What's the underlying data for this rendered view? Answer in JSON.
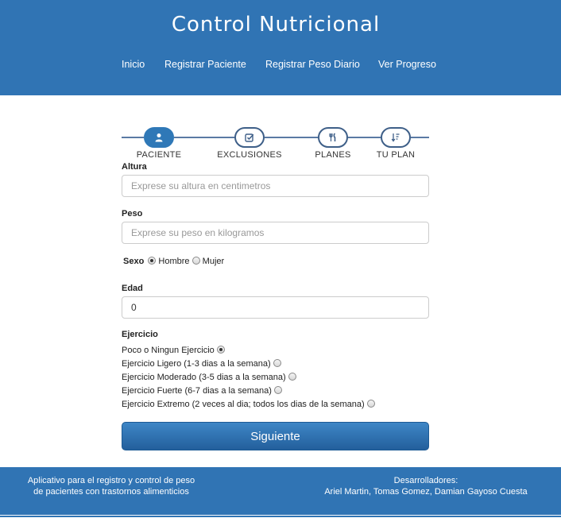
{
  "header": {
    "title": "Control Nutricional",
    "nav": [
      "Inicio",
      "Registrar Paciente",
      "Registrar Peso Diario",
      "Ver Progreso"
    ]
  },
  "stepper": {
    "steps": [
      {
        "label": "PACIENTE",
        "icon": "user-icon",
        "active": true
      },
      {
        "label": "EXCLUSIONES",
        "icon": "checkbox-icon",
        "active": false
      },
      {
        "label": "PLANES",
        "icon": "cutlery-icon",
        "active": false
      },
      {
        "label": "TU PLAN",
        "icon": "sort-icon",
        "active": false
      }
    ]
  },
  "form": {
    "altura": {
      "label": "Altura",
      "placeholder": "Exprese su altura en centimetros",
      "value": ""
    },
    "peso": {
      "label": "Peso",
      "placeholder": "Exprese su peso en kilogramos",
      "value": ""
    },
    "sexo": {
      "label": "Sexo",
      "options": [
        "Hombre",
        "Mujer"
      ],
      "selected": "Hombre"
    },
    "edad": {
      "label": "Edad",
      "value": "0"
    },
    "ejercicio": {
      "label": "Ejercicio",
      "options": [
        "Poco o Ningun Ejercicio",
        "Ejercicio Ligero (1-3 dias a la semana)",
        "Ejercicio Moderado (3-5 dias a la semana)",
        "Ejercicio Fuerte (6-7 dias a la semana)",
        "Ejercicio Extremo (2 veces al dia; todos los dias de la semana)"
      ],
      "selected": "Poco o Ningun Ejercicio"
    },
    "submit_label": "Siguiente"
  },
  "footer": {
    "left_line1": "Aplicativo para el registro y control de peso",
    "left_line2": "de pacientes con trastornos alimenticios",
    "right_line1": "Desarrolladores:",
    "right_line2": "Ariel Martin, Tomas Gomez, Damian Gayoso Cuesta"
  },
  "colors": {
    "primary": "#3074b4",
    "active_step": "#2f78b7"
  }
}
